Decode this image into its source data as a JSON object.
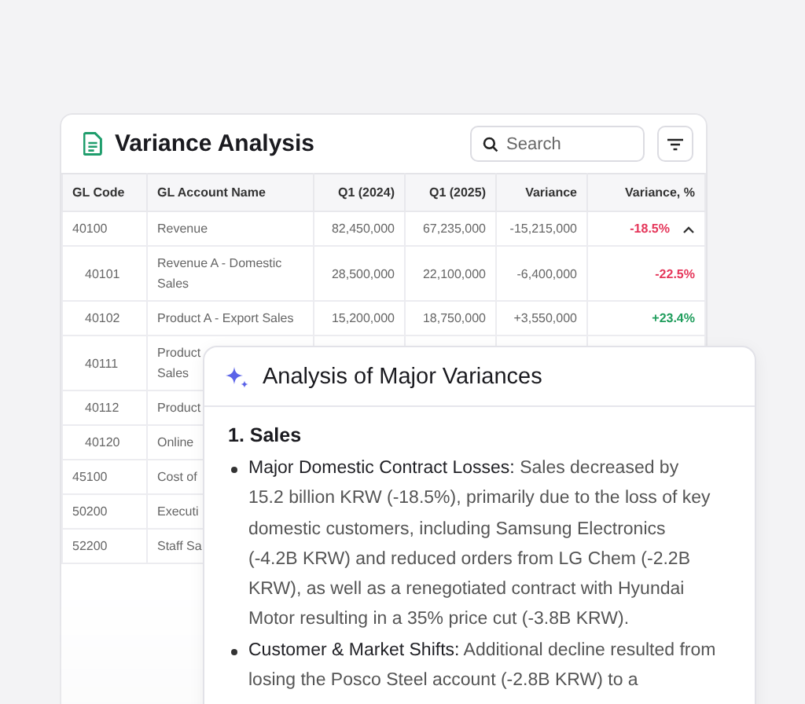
{
  "table_card": {
    "title": "Variance Analysis",
    "search": {
      "placeholder": "Search"
    },
    "columns": [
      "GL Code",
      "GL Account Name",
      "Q1 (2024)",
      "Q1 (2025)",
      "Variance",
      "Variance, %"
    ],
    "rows": [
      {
        "code": "40100",
        "name": "Revenue",
        "q1_2024": "82,450,000",
        "q1_2025": "67,235,000",
        "variance": "-15,215,000",
        "variance_pct": "-18.5%",
        "color": "#e5365a",
        "expanded": true,
        "children": [
          {
            "code": "40101",
            "name": "Revenue A - Domestic Sales",
            "q1_2024": "28,500,000",
            "q1_2025": "22,100,000",
            "variance": "-6,400,000",
            "variance_pct": "-22.5%",
            "color": "#e5365a"
          },
          {
            "code": "40102",
            "name": "Product A - Export Sales",
            "q1_2024": "15,200,000",
            "q1_2025": "18,750,000",
            "variance": "+3,550,000",
            "variance_pct": "+23.4%",
            "color": "#1f9d5c"
          },
          {
            "code": "40111",
            "name": "Product\nSales"
          },
          {
            "code": "40112",
            "name": "Product"
          },
          {
            "code": "40120",
            "name": "Online"
          }
        ]
      },
      {
        "code": "45100",
        "name": "Cost of"
      },
      {
        "code": "50200",
        "name": "Executi"
      },
      {
        "code": "52200",
        "name": "Staff Sa"
      }
    ]
  },
  "analysis_panel": {
    "title": "Analysis of Major Variances",
    "sections": [
      {
        "heading": "1. Sales",
        "bullets": [
          "**Major Domestic Contract Losses:** Sales decreased by 15.2 billion KRW (-18.5%), primarily due to the loss of key domestic customers, including Samsung Electronics (-4.2B KRW) and reduced orders from LG Chem (-2.2B KRW), as well as a renegotiated contract with Hyundai Motor resulting in a 35% price cut (-3.8B KRW).",
          "**Customer & Market Shifts:** Additional decline resulted from losing the Posco Steel account (-2.8B KRW) to a"
        ]
      }
    ]
  }
}
